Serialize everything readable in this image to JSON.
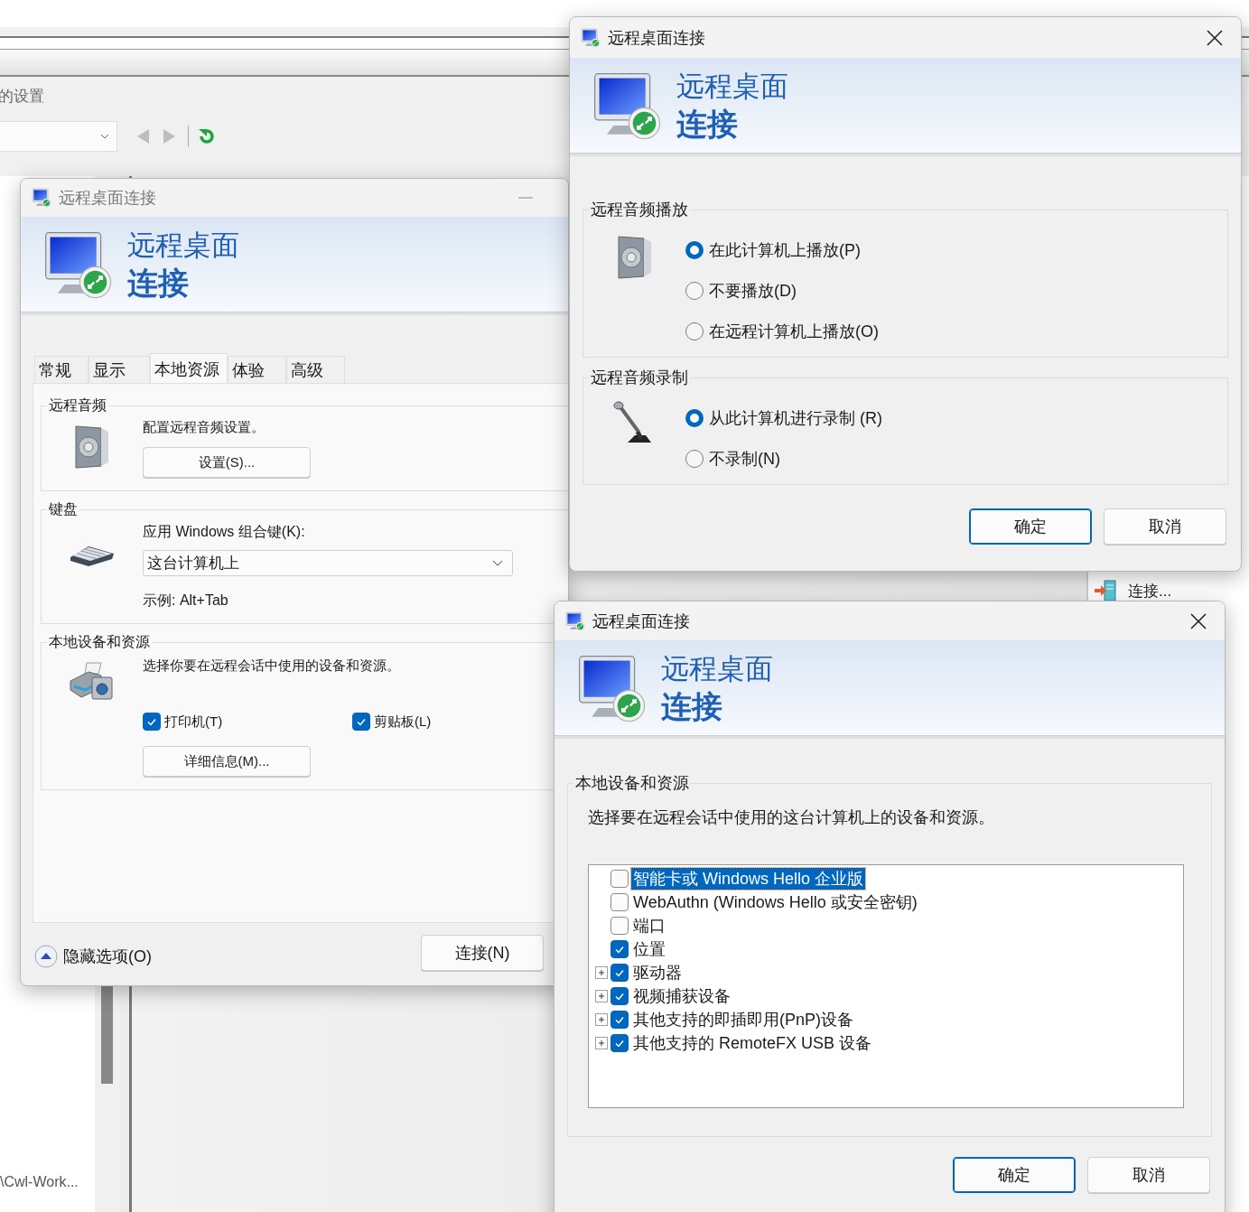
{
  "background_window": {
    "heading": "的设置",
    "tree_item": "\\Cwl-Work...",
    "action": "连接..."
  },
  "main_dialog": {
    "title": "远程桌面连接",
    "active": false,
    "banner": {
      "line1": "远程桌面",
      "line2": "连接"
    },
    "tabs": [
      {
        "label": "常规",
        "selected": false
      },
      {
        "label": "显示",
        "selected": false
      },
      {
        "label": "本地资源",
        "selected": true
      },
      {
        "label": "体验",
        "selected": false
      },
      {
        "label": "高级",
        "selected": false
      }
    ],
    "remote_audio": {
      "title": "远程音频",
      "description": "配置远程音频设置。",
      "button": "设置(S)..."
    },
    "keyboard": {
      "title": "键盘",
      "label": "应用 Windows 组合键(K):",
      "value": "这台计算机上",
      "example": "示例: Alt+Tab"
    },
    "local_devices": {
      "title": "本地设备和资源",
      "description": "选择你要在远程会话中使用的设备和资源。",
      "options": [
        {
          "label": "打印机(T)",
          "checked": true
        },
        {
          "label": "剪贴板(L)",
          "checked": true
        }
      ],
      "button": "详细信息(M)..."
    },
    "hide_options": "隐藏选项(O)",
    "connect": "连接(N)"
  },
  "audio_dialog": {
    "title": "远程桌面连接",
    "active": true,
    "banner": {
      "line1": "远程桌面",
      "line2": "连接"
    },
    "groups": [
      {
        "title": "远程音频播放",
        "options": [
          {
            "label": "在此计算机上播放(P)",
            "selected": true
          },
          {
            "label": "不要播放(D)",
            "selected": false
          },
          {
            "label": "在远程计算机上播放(O)",
            "selected": false
          }
        ]
      },
      {
        "title": "远程音频录制",
        "options": [
          {
            "label": "从此计算机进行录制 (R)",
            "selected": true
          },
          {
            "label": "不录制(N)",
            "selected": false
          }
        ]
      }
    ],
    "buttons": [
      {
        "label": "确定",
        "default": true
      },
      {
        "label": "取消",
        "default": false
      }
    ]
  },
  "devices_dialog": {
    "title": "远程桌面连接",
    "active": true,
    "banner": {
      "line1": "远程桌面",
      "line2": "连接"
    },
    "group_title": "本地设备和资源",
    "description": "选择要在远程会话中使用的这台计算机上的设备和资源。",
    "items": [
      {
        "label": "智能卡或 Windows Hello 企业版",
        "checked": false,
        "selected": true,
        "expandable": false
      },
      {
        "label": "WebAuthn (Windows Hello 或安全密钥)",
        "checked": false,
        "selected": false,
        "expandable": false
      },
      {
        "label": "端口",
        "checked": false,
        "selected": false,
        "expandable": false
      },
      {
        "label": "位置",
        "checked": true,
        "selected": false,
        "expandable": false
      },
      {
        "label": "驱动器",
        "checked": true,
        "selected": false,
        "expandable": true
      },
      {
        "label": "视频捕获设备",
        "checked": true,
        "selected": false,
        "expandable": true
      },
      {
        "label": "其他支持的即插即用(PnP)设备",
        "checked": true,
        "selected": false,
        "expandable": true
      },
      {
        "label": "其他支持的 RemoteFX USB 设备",
        "checked": true,
        "selected": false,
        "expandable": true
      }
    ],
    "buttons": [
      {
        "label": "确定",
        "default": true
      },
      {
        "label": "取消",
        "default": false
      }
    ]
  }
}
